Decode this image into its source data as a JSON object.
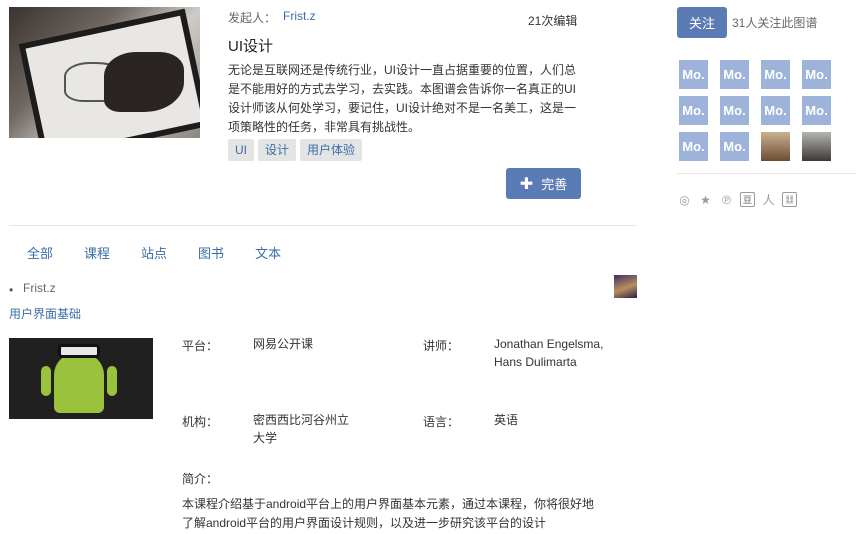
{
  "header": {
    "initiator_label": "发起人：",
    "initiator_name": "Frist.z",
    "edit_count": "21次编辑",
    "title": "UI设计",
    "description": "无论是互联网还是传统行业，UI设计一直占据重要的位置，人们总是不能用好的方式去学习，去实践。本图谱会告诉你一名真正的UI设计师该从何处学习，要记住，UI设计绝对不是一名美工，这是一项策略性的任务，非常具有挑战性。",
    "tags": [
      "UI",
      "设计",
      "用户体验"
    ],
    "complete_label": "完善"
  },
  "tabs": [
    "全部",
    "课程",
    "站点",
    "图书",
    "文本"
  ],
  "list": {
    "user": "Frist.z",
    "course": {
      "title": "用户界面基础",
      "platform_label": "平台：",
      "platform": "网易公开课",
      "teacher_label": "讲师：",
      "teacher": "Jonathan Engelsma, Hans Dulimarta",
      "org_label": "机构：",
      "org": "密西西比河谷州立大学",
      "lang_label": "语言：",
      "lang": "英语",
      "intro_label": "简介：",
      "intro": "本课程介绍基于android平台上的用户界面基本元素，通过本课程，你将很好地了解android平台的用户界面设计规则，以及进一步研究该平台的设计"
    }
  },
  "sidebar": {
    "follow_label": "关注",
    "follow_count": "31人关注此图谱",
    "avatar_placeholder": "Mo.",
    "share_icons": [
      "weibo-icon",
      "star-icon",
      "pinterest-icon",
      "douban-icon",
      "renren-icon",
      "copy-icon"
    ],
    "share_glyphs": [
      "◎",
      "★",
      "℗",
      "豆",
      "人",
      "䷗"
    ]
  },
  "colors": {
    "accent": "#5b7bb5",
    "link": "#3a6ea5"
  }
}
